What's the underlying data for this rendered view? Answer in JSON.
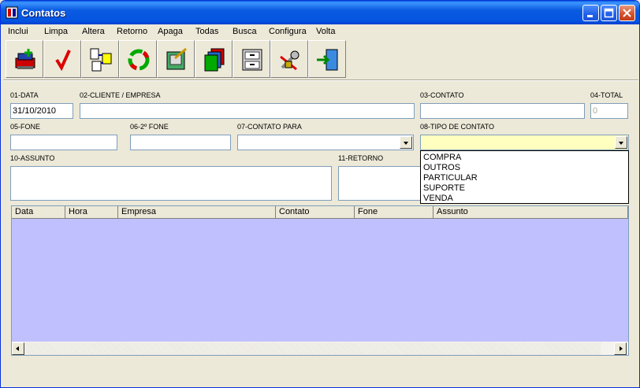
{
  "window": {
    "title": "Contatos"
  },
  "menu": [
    "Inclui",
    "Limpa",
    "Altera",
    "Retorno",
    "Apaga",
    "Todas",
    "Busca",
    "Configura",
    "Volta"
  ],
  "toolbar_icons": [
    "add-record-icon",
    "check-icon",
    "move-records-icon",
    "refresh-icon",
    "edit-icon",
    "folders-icon",
    "file-cabinet-icon",
    "tools-icon",
    "exit-door-icon"
  ],
  "form": {
    "data": {
      "label": "01-DATA",
      "value": "31/10/2010"
    },
    "cliente": {
      "label": "02-CLIENTE / EMPRESA",
      "value": ""
    },
    "contato": {
      "label": "03-CONTATO",
      "value": ""
    },
    "total": {
      "label": "04-TOTAL",
      "value": "0"
    },
    "fone": {
      "label": "05-FONE",
      "value": ""
    },
    "fone2": {
      "label": "06-2º FONE",
      "value": ""
    },
    "contato_para": {
      "label": "07-CONTATO PARA",
      "value": ""
    },
    "tipo": {
      "label": "08-TIPO DE CONTATO",
      "value": "",
      "options": [
        "COMPRA",
        "OUTROS",
        "PARTICULAR",
        "SUPORTE",
        "VENDA"
      ]
    },
    "assunto": {
      "label": "10-ASSUNTO"
    },
    "retorno": {
      "label": "11-RETORNO"
    }
  },
  "grid": {
    "columns": [
      "Data",
      "Hora",
      "Empresa",
      "Contato",
      "Fone",
      "Assunto"
    ]
  },
  "colors": {
    "grid_bg": "#c0c0ff",
    "tipo_bg": "#ffffc0",
    "titlebar": "#0454e1"
  }
}
